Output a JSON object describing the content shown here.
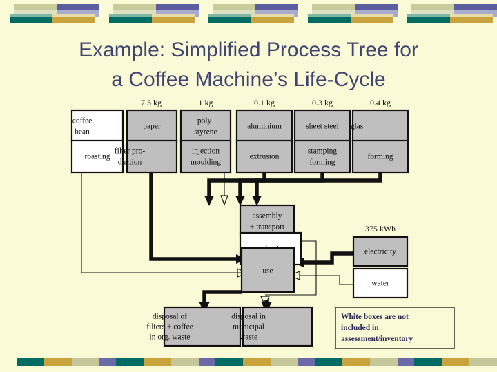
{
  "slide": {
    "title_line1": "Example: Simplified Process Tree for",
    "title_line2": "a Coffee Machine’s Life-Cycle",
    "background_color": "#FAFAD7",
    "title_color": "#3F4470"
  },
  "decor": {
    "top_colors": [
      "#C8CC9B",
      "#5B5E9E",
      "#DDE1C2",
      "#A8ABCB",
      "#006B63",
      "#C9A43C",
      "#7FB6A4",
      "#E8DBAA"
    ],
    "bottom_colors": [
      "#006B63",
      "#C9A43C",
      "#C3C79A",
      "#6A6AA8"
    ],
    "top_unit_count": 5,
    "bottom_unit_count": 5
  },
  "diagram": {
    "type": "process-tree",
    "box_fill_included": "#BFBFBF",
    "box_fill_excluded": "#FFFFFF",
    "materials": [
      {
        "id": "coffee-bean",
        "label_line1": "coffee",
        "label_line2": "bean",
        "weight": "",
        "included": false
      },
      {
        "id": "paper",
        "label_line1": "paper",
        "label_line2": "",
        "weight": "7.3 kg",
        "included": true
      },
      {
        "id": "polystyrene",
        "label_line1": "poly-",
        "label_line2": "styrene",
        "weight": "1 kg",
        "included": true
      },
      {
        "id": "aluminium",
        "label_line1": "aluminium",
        "label_line2": "",
        "weight": "0.1 kg",
        "included": true
      },
      {
        "id": "sheet-steel",
        "label_line1": "sheet steel",
        "label_line2": "",
        "weight": "0.3 kg",
        "included": true
      },
      {
        "id": "glas",
        "label_line1": "glas",
        "label_line2": "",
        "weight": "0.4 kg",
        "included": true
      }
    ],
    "processes": [
      {
        "id": "roasting",
        "label_line1": "roasting",
        "label_line2": "",
        "included": false
      },
      {
        "id": "filter-production",
        "label_line1": "filter pro-",
        "label_line2": "duction",
        "included": true
      },
      {
        "id": "injection-moulding",
        "label_line1": "injection",
        "label_line2": "moulding",
        "included": true
      },
      {
        "id": "extrusion",
        "label_line1": "extrusion",
        "label_line2": "",
        "included": true
      },
      {
        "id": "stamping-forming",
        "label_line1": "stamping",
        "label_line2": "forming",
        "included": true
      },
      {
        "id": "forming",
        "label_line1": "forming",
        "label_line2": "",
        "included": true
      }
    ],
    "core": [
      {
        "id": "assembly",
        "label_line1": "assembly",
        "label_line2": "+ transport",
        "included": true
      },
      {
        "id": "packaging",
        "label_line1": "packaging",
        "label_line2": "",
        "included": false
      },
      {
        "id": "use",
        "label_line1": "use",
        "label_line2": "",
        "included": true
      }
    ],
    "resources": [
      {
        "id": "electricity",
        "label_line1": "electricity",
        "weight": "375 kWh",
        "included": true
      },
      {
        "id": "water",
        "label_line1": "water",
        "weight": "",
        "included": false
      }
    ],
    "disposal": [
      {
        "id": "disposal-organic",
        "label_line1": "disposal of",
        "label_line2": "filters + coffee",
        "label_line3": "in org. waste",
        "included": true
      },
      {
        "id": "disposal-municipal",
        "label_line1": "disposal in",
        "label_line2": "municipal",
        "label_line3": "waste",
        "included": true
      }
    ],
    "legend": {
      "line1": "White boxes are not",
      "line2": "included in",
      "line3": "assessment/inventory"
    }
  }
}
